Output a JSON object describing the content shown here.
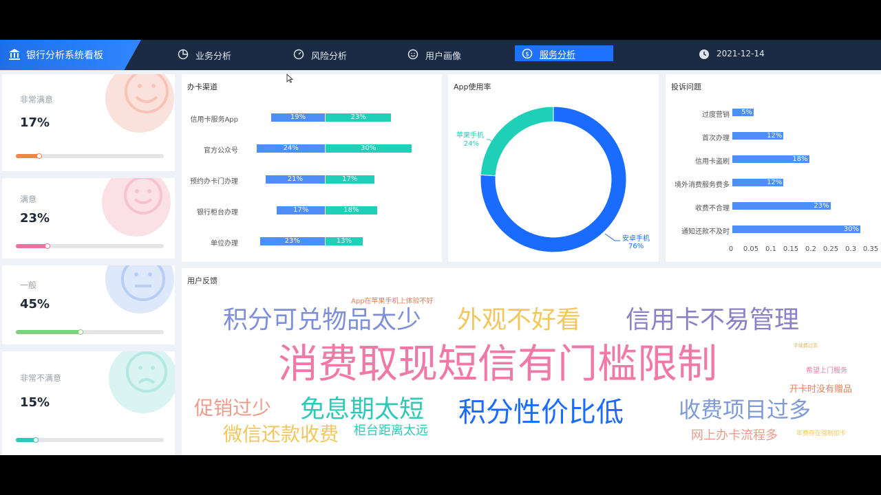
{
  "header": {
    "title": "银行分析系统看板",
    "nav": [
      {
        "label": "业务分析",
        "icon": "pie-chart-icon"
      },
      {
        "label": "风险分析",
        "icon": "gauge-icon"
      },
      {
        "label": "用户画像",
        "icon": "smile-icon"
      },
      {
        "label": "服务分析",
        "icon": "dollar-icon",
        "active": true
      }
    ],
    "date": "2021-12-14"
  },
  "satisfaction": [
    {
      "label": "非常满意",
      "value": "17%",
      "percent": 0.17,
      "color": "#f0844b",
      "face": "#fbe1dc"
    },
    {
      "label": "满意",
      "value": "23%",
      "percent": 0.23,
      "color": "#f06fa0",
      "face": "#fbe0e6"
    },
    {
      "label": "一般",
      "value": "45%",
      "percent": 0.45,
      "color": "#7ed27e",
      "face": "#dde8fb"
    },
    {
      "label": "非常不满意",
      "value": "15%",
      "percent": 0.15,
      "color": "#29c7bd",
      "face": "#daf4f2"
    }
  ],
  "panels": {
    "channel_title": "办卡渠道",
    "app_title": "App使用率",
    "complaint_title": "投诉问题",
    "feedback_title": "用户反馈"
  },
  "channel": {
    "rows": [
      {
        "label": "信用卡服务App",
        "a": "19%",
        "b": "23%"
      },
      {
        "label": "官方公众号",
        "a": "24%",
        "b": "30%"
      },
      {
        "label": "预约办卡门办理",
        "a": "21%",
        "b": "17%"
      },
      {
        "label": "银行柜台办理",
        "a": "17%",
        "b": "18%"
      },
      {
        "label": "单位办理",
        "a": "23%",
        "b": "13%"
      }
    ],
    "colors": [
      "#4e8ef7",
      "#1fcfb7"
    ]
  },
  "app": {
    "slices": [
      {
        "name": "苹果手机",
        "value": "24%"
      },
      {
        "name": "安卓手机",
        "value": "76%"
      }
    ],
    "colors": [
      "#1fcfb7",
      "#1a6bff"
    ]
  },
  "complaints": {
    "rows": [
      {
        "label": "过度营销",
        "value": "5%"
      },
      {
        "label": "首次办理",
        "value": "12%"
      },
      {
        "label": "信用卡盗刷",
        "value": "18%"
      },
      {
        "label": "境外消费服务费多",
        "value": "12%"
      },
      {
        "label": "收费不合理",
        "value": "23%"
      },
      {
        "label": "通知还款不及时",
        "value": "30%"
      }
    ],
    "ticks": [
      "0",
      "0.05",
      "0.1",
      "0.15",
      "0.2",
      "0.25",
      "0.3",
      "0.35"
    ],
    "color": "#4e8ef7"
  },
  "feedback": {
    "words": [
      {
        "text": "App在苹果手机上体验不好",
        "color": "#e3815a"
      },
      {
        "text": "积分可兑物品太少",
        "color": "#7d8fd8"
      },
      {
        "text": "外观不好看",
        "color": "#f2c75c"
      },
      {
        "text": "信用卡不易管理",
        "color": "#8b7fc8"
      },
      {
        "text": "消费取现短信有门槛限制",
        "color": "#f079a8"
      },
      {
        "text": "促销过少",
        "color": "#f09b8a"
      },
      {
        "text": "免息期太短",
        "color": "#2ec9b6"
      },
      {
        "text": "积分性价比低",
        "color": "#1a6bff"
      },
      {
        "text": "收费项目过多",
        "color": "#7d9bd8"
      },
      {
        "text": "微信还款收费",
        "color": "#f2c75c"
      },
      {
        "text": "柜台距离太远",
        "color": "#2ec9b6"
      },
      {
        "text": "开卡时没有赠品",
        "color": "#e3815a"
      },
      {
        "text": "希望上门服务",
        "color": "#f079a8"
      },
      {
        "text": "网上办卡流程多",
        "color": "#f09b8a"
      },
      {
        "text": "手续费过高",
        "color": "#e8b35c"
      },
      {
        "text": "年费存在强制扣卡",
        "color": "#f2c75c"
      }
    ]
  }
}
